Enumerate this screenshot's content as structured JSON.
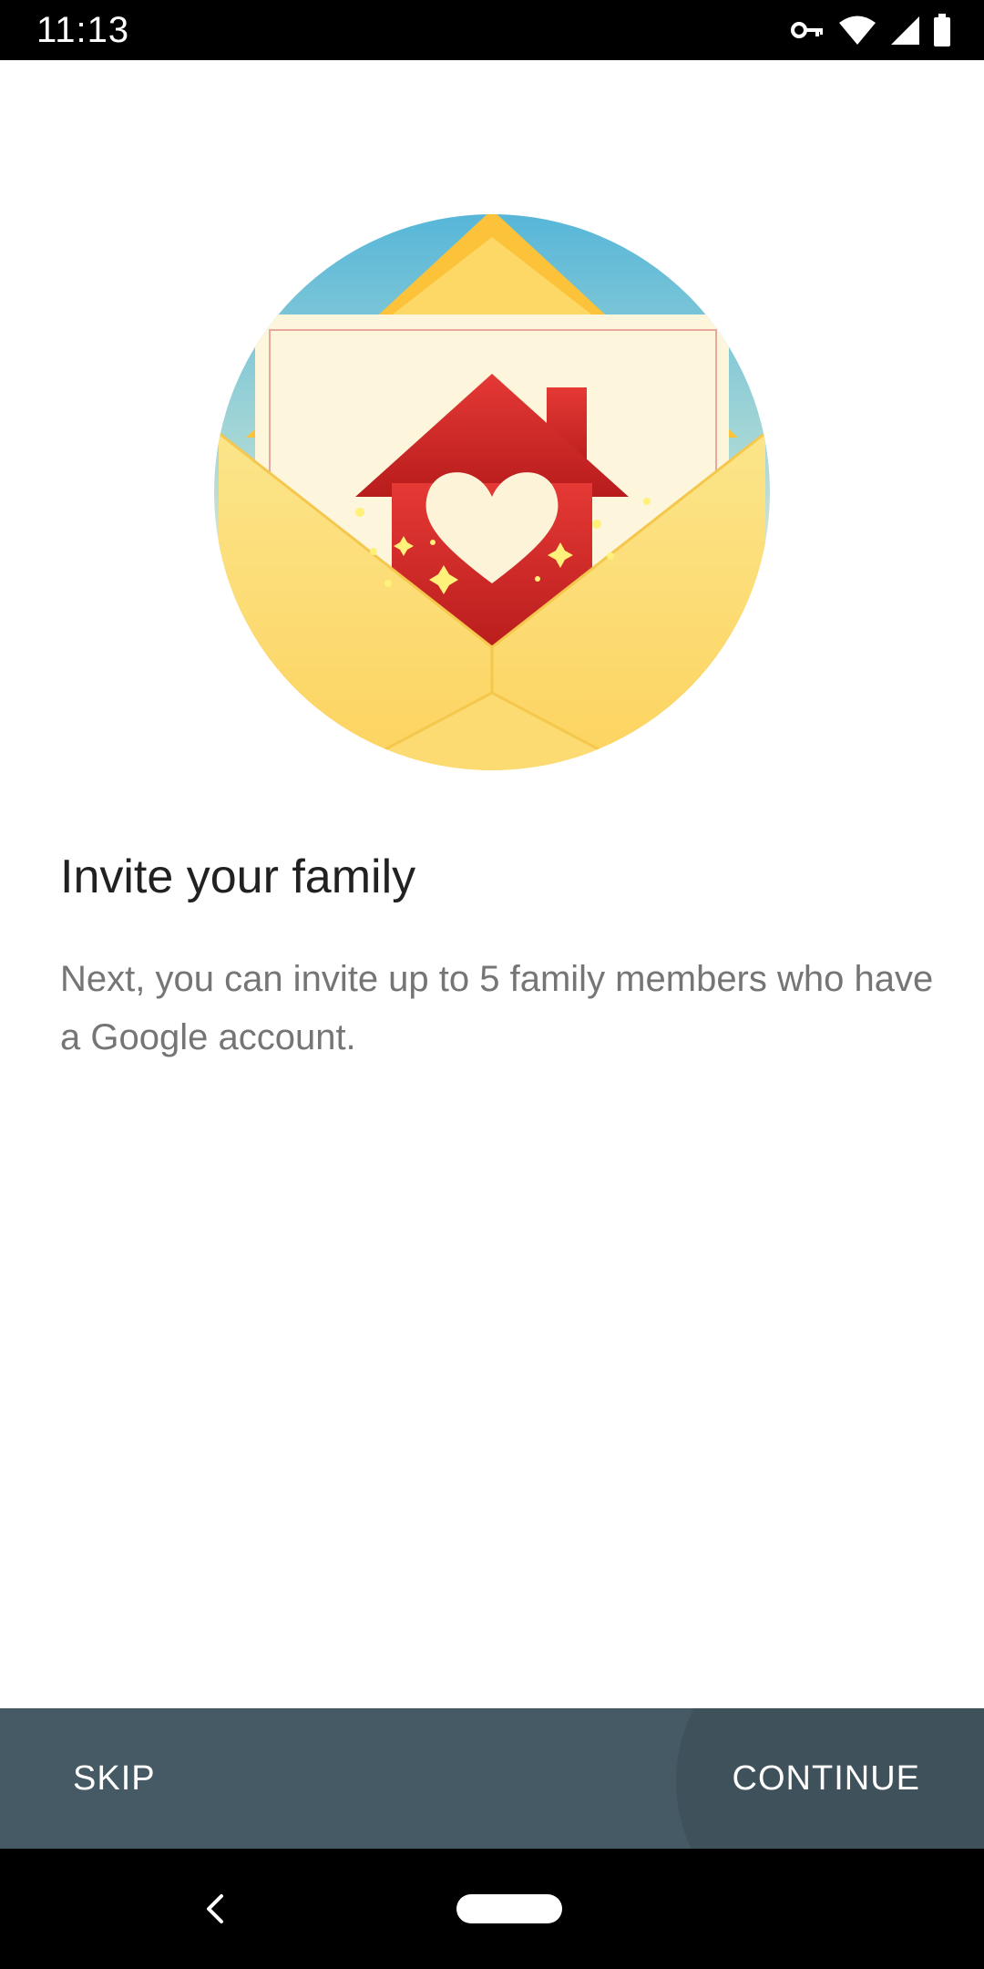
{
  "status_bar": {
    "time": "11:13",
    "icons": [
      "vpn-key-icon",
      "wifi-icon",
      "cell-signal-icon",
      "battery-icon"
    ]
  },
  "illustration": {
    "name": "invite-envelope-house-heart",
    "colors": {
      "sky": "#56b6d6",
      "envelope": "#fdd667",
      "paper": "#fdf6dd",
      "house": "#d32f2f",
      "heart": "#fff3d6"
    }
  },
  "content": {
    "title": "Invite your family",
    "body": "Next, you can invite up to 5 family members who have a Google account."
  },
  "actions": {
    "skip_label": "SKIP",
    "continue_label": "CONTINUE",
    "bar_color": "#455a64"
  },
  "navigation": {
    "icons": [
      "back-icon",
      "home-pill-icon"
    ]
  }
}
